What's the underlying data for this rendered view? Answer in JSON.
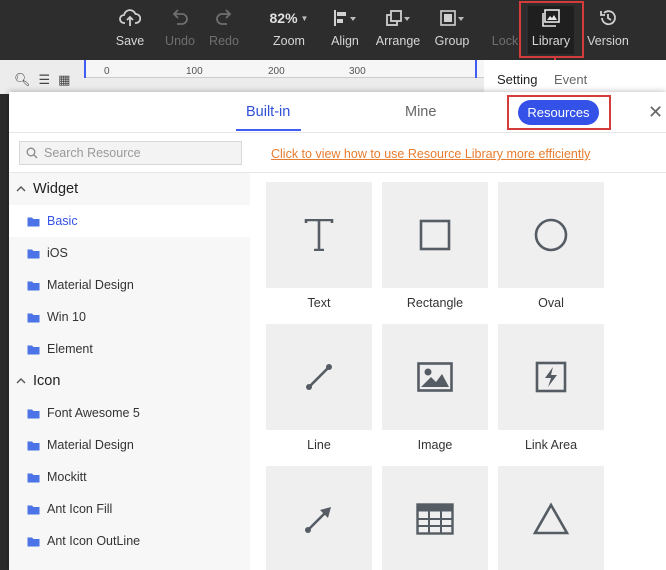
{
  "toolbar": {
    "save": "Save",
    "undo": "Undo",
    "redo": "Redo",
    "zoom_value": "82%",
    "zoom": "Zoom",
    "align": "Align",
    "arrange": "Arrange",
    "group": "Group",
    "lock": "Lock",
    "library": "Library",
    "version": "Version"
  },
  "ruler": [
    "0",
    "100",
    "200",
    "300"
  ],
  "right_panel": {
    "setting": "Setting",
    "event": "Event"
  },
  "modal": {
    "tabs": {
      "builtin": "Built-in",
      "mine": "Mine",
      "resources": "Resources"
    },
    "search_placeholder": "Search Resource",
    "help_link": "Click to view how to use Resource Library more efficiently",
    "sidebar": {
      "widget_title": "Widget",
      "widget_items": [
        "Basic",
        "iOS",
        "Material Design",
        "Win 10",
        "Element"
      ],
      "icon_title": "Icon",
      "icon_items": [
        "Font Awesome 5",
        "Material Design",
        "Mockitt",
        "Ant Icon Fill",
        "Ant Icon OutLine"
      ]
    },
    "tiles": [
      "Text",
      "Rectangle",
      "Oval",
      "Line",
      "Image",
      "Link Area"
    ],
    "accent": "#3452e8"
  }
}
